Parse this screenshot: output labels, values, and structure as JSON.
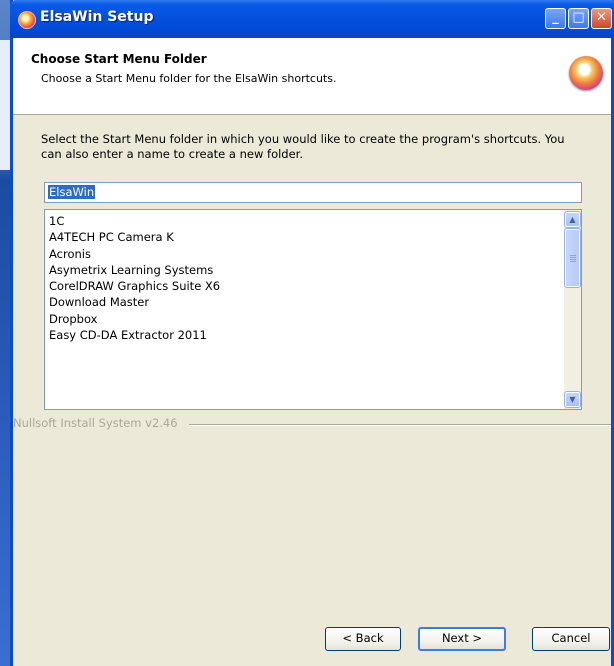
{
  "window": {
    "title": "ElsaWin Setup",
    "controls": {
      "minimize": "_",
      "maximize": "□",
      "close": "✕"
    }
  },
  "header": {
    "title": "Choose Start Menu Folder",
    "subtitle": "Choose a Start Menu folder for the ElsaWin shortcuts."
  },
  "body": {
    "instructions": "Select the Start Menu folder in which you would like to create the program's shortcuts. You can also enter a name to create a new folder.",
    "folder_input": {
      "value": "ElsaWin"
    },
    "folders": [
      "1C",
      "A4TECH PC Camera K",
      "Acronis",
      "Asymetrix Learning Systems",
      "CorelDRAW Graphics Suite X6",
      "Download Master",
      "Dropbox",
      "Easy CD-DA Extractor 2011"
    ]
  },
  "branding": "Nullsoft Install System v2.46",
  "buttons": {
    "back": "< Back",
    "next": "Next >",
    "cancel": "Cancel"
  },
  "colors": {
    "titlebar": "#0553e0",
    "dialog_bg": "#ece9d8",
    "selection": "#316ac5"
  }
}
